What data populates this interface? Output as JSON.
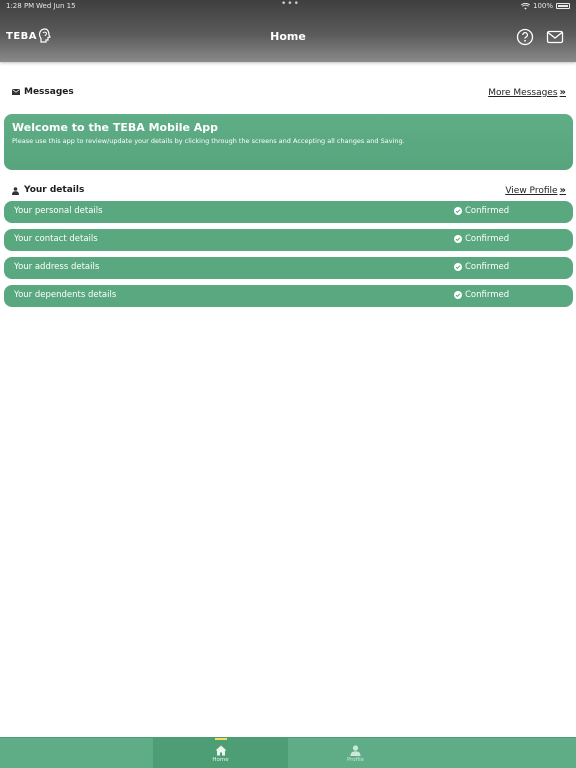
{
  "status_bar": {
    "time": "1:28 PM",
    "date": "Wed Jun 15",
    "battery": "100%"
  },
  "header": {
    "logo": "TEBA",
    "title": "Home"
  },
  "messages": {
    "title": "Messages",
    "more_link": "More Messages",
    "card_title": "Welcome to the TEBA Mobile App",
    "card_text": "Please use this app to review/update your details by clicking through the screens and Accepting all changes and Saving."
  },
  "details": {
    "title": "Your details",
    "view_link": "View Profile",
    "rows": [
      {
        "label": "Your personal details",
        "status": "Confirmed"
      },
      {
        "label": "Your contact details",
        "status": "Confirmed"
      },
      {
        "label": "Your address details",
        "status": "Confirmed"
      },
      {
        "label": "Your dependents details",
        "status": "Confirmed"
      }
    ]
  },
  "tabs": [
    {
      "label": "Home",
      "icon": "home-icon",
      "active": true
    },
    {
      "label": "Profile",
      "icon": "person-icon",
      "active": false
    }
  ],
  "colors": {
    "accent": "#5aa880",
    "header": "#4a4a4a",
    "active_tab_marker": "#f1e15a"
  }
}
